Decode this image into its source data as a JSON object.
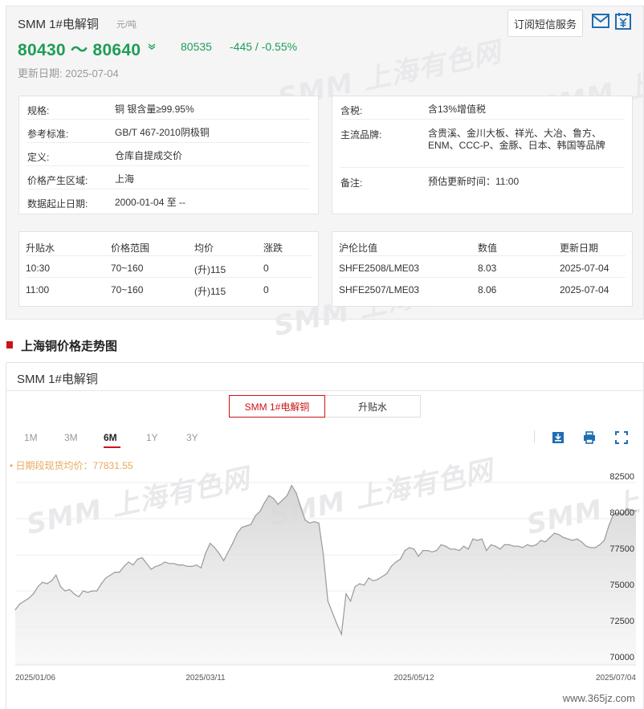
{
  "product": {
    "title": "SMM 1#电解铜",
    "unit": "元/吨",
    "price_range": "80430 ～ 80640",
    "trend_icon": "double-chevron-down-icon",
    "avg_price": "80535",
    "change": "-445 / -0.55%",
    "update_label": "更新日期:",
    "update_date": "2025-07-04",
    "subscribe_label": "订阅短信服务",
    "price_color": "#1f9d55"
  },
  "watermark": "SMM 上海有色网",
  "specs_left": [
    {
      "label": "规格:",
      "value": "铜 银含量≥99.95%"
    },
    {
      "label": "参考标准:",
      "value": "GB/T 467-2010阴极铜"
    },
    {
      "label": "定义:",
      "value": "仓库自提成交价"
    },
    {
      "label": "价格产生区域:",
      "value": "上海"
    },
    {
      "label": "数据起止日期:",
      "value": "2000-01-04 至 --"
    }
  ],
  "specs_right": [
    {
      "label": "含税:",
      "value": "含13%增值税"
    },
    {
      "label": "主流品牌:",
      "value": "含贵溪、金川大板、祥光、大冶、鲁方、",
      "value2": "ENM、CCC-P、金豚、日本、韩国等品牌"
    },
    {
      "label": "备注:",
      "value": "预估更新时间：11:00"
    }
  ],
  "premium_table": {
    "headers": [
      "升贴水",
      "价格范围",
      "均价",
      "涨跌"
    ],
    "rows": [
      [
        "10:30",
        "70~160",
        "(升)115",
        "0"
      ],
      [
        "11:00",
        "70~160",
        "(升)115",
        "0"
      ]
    ]
  },
  "ratio_table": {
    "headers": [
      "沪伦比值",
      "数值",
      "更新日期"
    ],
    "rows": [
      [
        "SHFE2508/LME03",
        "8.03",
        "2025-07-04"
      ],
      [
        "SHFE2507/LME03",
        "8.06",
        "2025-07-04"
      ]
    ]
  },
  "section_title": "上海铜价格走势图",
  "chart_panel": {
    "title": "SMM 1#电解铜",
    "tabs": [
      {
        "label": "SMM 1#电解铜",
        "active": true
      },
      {
        "label": "升贴水",
        "active": false
      }
    ],
    "ranges": [
      {
        "label": "1M",
        "active": false
      },
      {
        "label": "3M",
        "active": false
      },
      {
        "label": "6M",
        "active": true
      },
      {
        "label": "1Y",
        "active": false
      },
      {
        "label": "3Y",
        "active": false
      }
    ],
    "tools": [
      "download-image-icon",
      "print-icon",
      "fullscreen-icon"
    ],
    "avg_note": "• 日期段现货均价：77831.55",
    "accent_color": "#cc1417"
  },
  "site_mark": "www.365jz.com",
  "chart_data": {
    "type": "area",
    "title": "SMM 1#电解铜",
    "xlabel": "",
    "ylabel": "",
    "ylim": [
      70000,
      83500
    ],
    "yticks": [
      70000,
      72500,
      75000,
      77500,
      80000,
      82500
    ],
    "xticks": [
      "2025/01/06",
      "2025/03/11",
      "2025/05/12",
      "2025/07/04"
    ],
    "grid": true,
    "series": [
      {
        "values": [
          73700,
          74100,
          74300,
          74500,
          74800,
          75300,
          75600,
          75500,
          75700,
          76100,
          75300,
          75000,
          75100,
          74800,
          74600,
          75000,
          74900,
          75000,
          75000,
          75500,
          75900,
          76100,
          76300,
          76300,
          76700,
          77000,
          76800,
          77200,
          77300,
          76900,
          76500,
          76700,
          76800,
          77000,
          76900,
          76900,
          76800,
          76800,
          76700,
          76700,
          76800,
          76600,
          77600,
          78300,
          78000,
          77600,
          77100,
          77700,
          78300,
          79000,
          79400,
          79500,
          79600,
          80200,
          80500,
          81100,
          81600,
          81400,
          81000,
          81300,
          81600,
          82300,
          81800,
          80800,
          79900,
          79700,
          79800,
          79700,
          77500,
          74300,
          73500,
          72700,
          72000,
          74800,
          74300,
          75300,
          75500,
          75400,
          75900,
          75700,
          75800,
          76000,
          76200,
          76700,
          77000,
          77200,
          77800,
          78000,
          77900,
          77400,
          77800,
          77800,
          77700,
          77800,
          78200,
          78100,
          77900,
          77900,
          77800,
          78100,
          77900,
          78600,
          78500,
          78600,
          77800,
          78200,
          78100,
          77900,
          78200,
          78200,
          78100,
          78100,
          78000,
          78200,
          78100,
          78200,
          78500,
          78400,
          78700,
          79000,
          78900,
          78700,
          78600,
          78500,
          78600,
          78400,
          78100,
          78000,
          78000,
          78200,
          78500,
          79500,
          80300,
          80400,
          80300,
          80700,
          80600,
          80535
        ]
      }
    ]
  }
}
